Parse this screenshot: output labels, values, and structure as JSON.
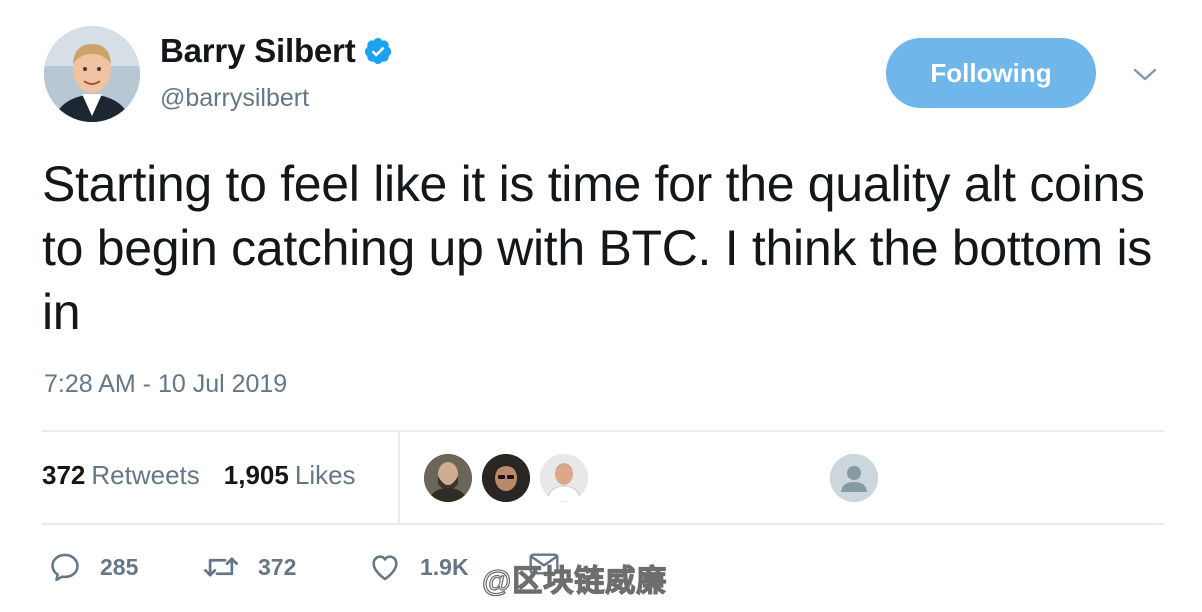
{
  "user": {
    "display_name": "Barry Silbert",
    "handle": "@barrysilbert",
    "verified": true
  },
  "follow_button": {
    "label": "Following"
  },
  "tweet": {
    "text": "Starting to feel like it is time for the quality alt coins to begin catching up with BTC. I think the bottom is in",
    "timestamp": "7:28 AM - 10 Jul 2019"
  },
  "stats": {
    "retweets_count": "372",
    "retweets_label": "Retweets",
    "likes_count": "1,905",
    "likes_label": "Likes"
  },
  "actions": {
    "reply_count": "285",
    "retweet_count": "372",
    "like_count": "1.9K"
  },
  "watermark": "@区块链威廉",
  "colors": {
    "accent": "#1da1f2",
    "follow_button_bg": "#6fb6ea",
    "secondary_text": "#657786",
    "divider": "#e6ecf0"
  },
  "icons": {
    "verified": "verified-badge-icon",
    "more": "chevron-down-icon",
    "reply": "reply-icon",
    "retweet": "retweet-icon",
    "like": "heart-icon",
    "dm": "envelope-icon"
  }
}
